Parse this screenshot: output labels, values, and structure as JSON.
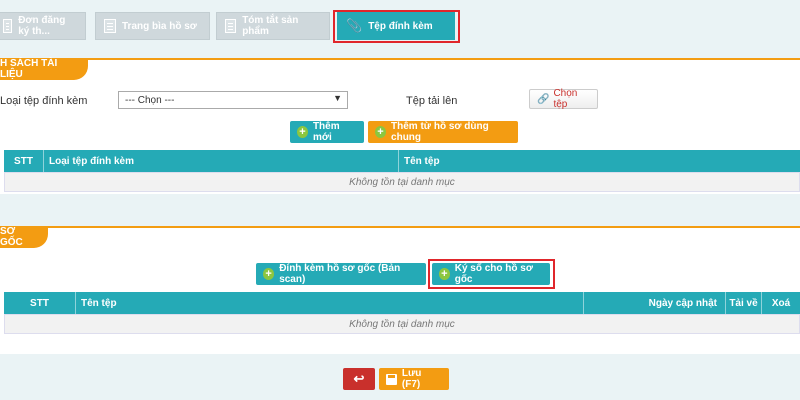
{
  "tabs": [
    {
      "label": "Đơn đăng ký th..."
    },
    {
      "label": "Trang bìa hồ sơ"
    },
    {
      "label": "Tóm tắt sản phẩm"
    },
    {
      "label": "Tệp đính kèm"
    }
  ],
  "section1": {
    "title": "H SÁCH TÀI LIỆU",
    "file_type_label": "Loại tệp đính kèm",
    "file_type_selected": "--- Chọn ---",
    "upload_label": "Tệp tải lên",
    "choose_file_label": "Chọn tệp",
    "add_new_label": "Thêm mới",
    "add_from_shared_label": "Thêm từ hồ sơ dùng chung",
    "table": {
      "headers": [
        "STT",
        "Loại tệp đính kèm",
        "Tên tệp"
      ],
      "empty_text": "Không tồn tại danh mục"
    }
  },
  "section2": {
    "title": "SƠ GỐC",
    "attach_original_label": "Đính kèm hồ sơ gốc (Bản scan)",
    "sign_original_label": "Ký số cho hồ sơ gốc",
    "table": {
      "headers": [
        "STT",
        "Tên tệp",
        "Ngày cập nhật",
        "Tải về",
        "Xoá"
      ],
      "empty_text": "Không tồn tại danh mục"
    }
  },
  "footer": {
    "save_label": "Lưu (F7)"
  },
  "colors": {
    "teal": "#25aab6",
    "orange": "#f39c12",
    "red": "#c9302c",
    "highlight": "#e0262b"
  }
}
